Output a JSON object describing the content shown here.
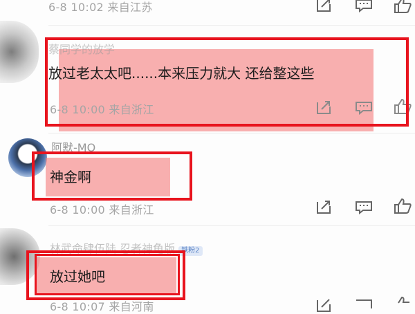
{
  "comments": [
    {
      "meta": "6-8 10:02  来自江苏"
    },
    {
      "username": "蔡同学的放学",
      "text": "放过老太太吧......本来压力就大 还给整这些",
      "meta": "6-8 10:00  来自浙江"
    },
    {
      "username": "阿默-MO",
      "text": "神金啊",
      "meta": "6-8 10:00  来自浙江"
    },
    {
      "username": "林武命肆伍陆  忍者神龟版",
      "badge": "铁粉2",
      "text": "放过她吧",
      "meta": "6-8 10:07  来自河南"
    }
  ],
  "icons": {
    "share": "share-icon",
    "comment": "comment-icon",
    "like": "thumbs-up-icon"
  },
  "colors": {
    "highlight": "#f68080",
    "box": "#e8141e",
    "meta": "#a5a5a5"
  }
}
